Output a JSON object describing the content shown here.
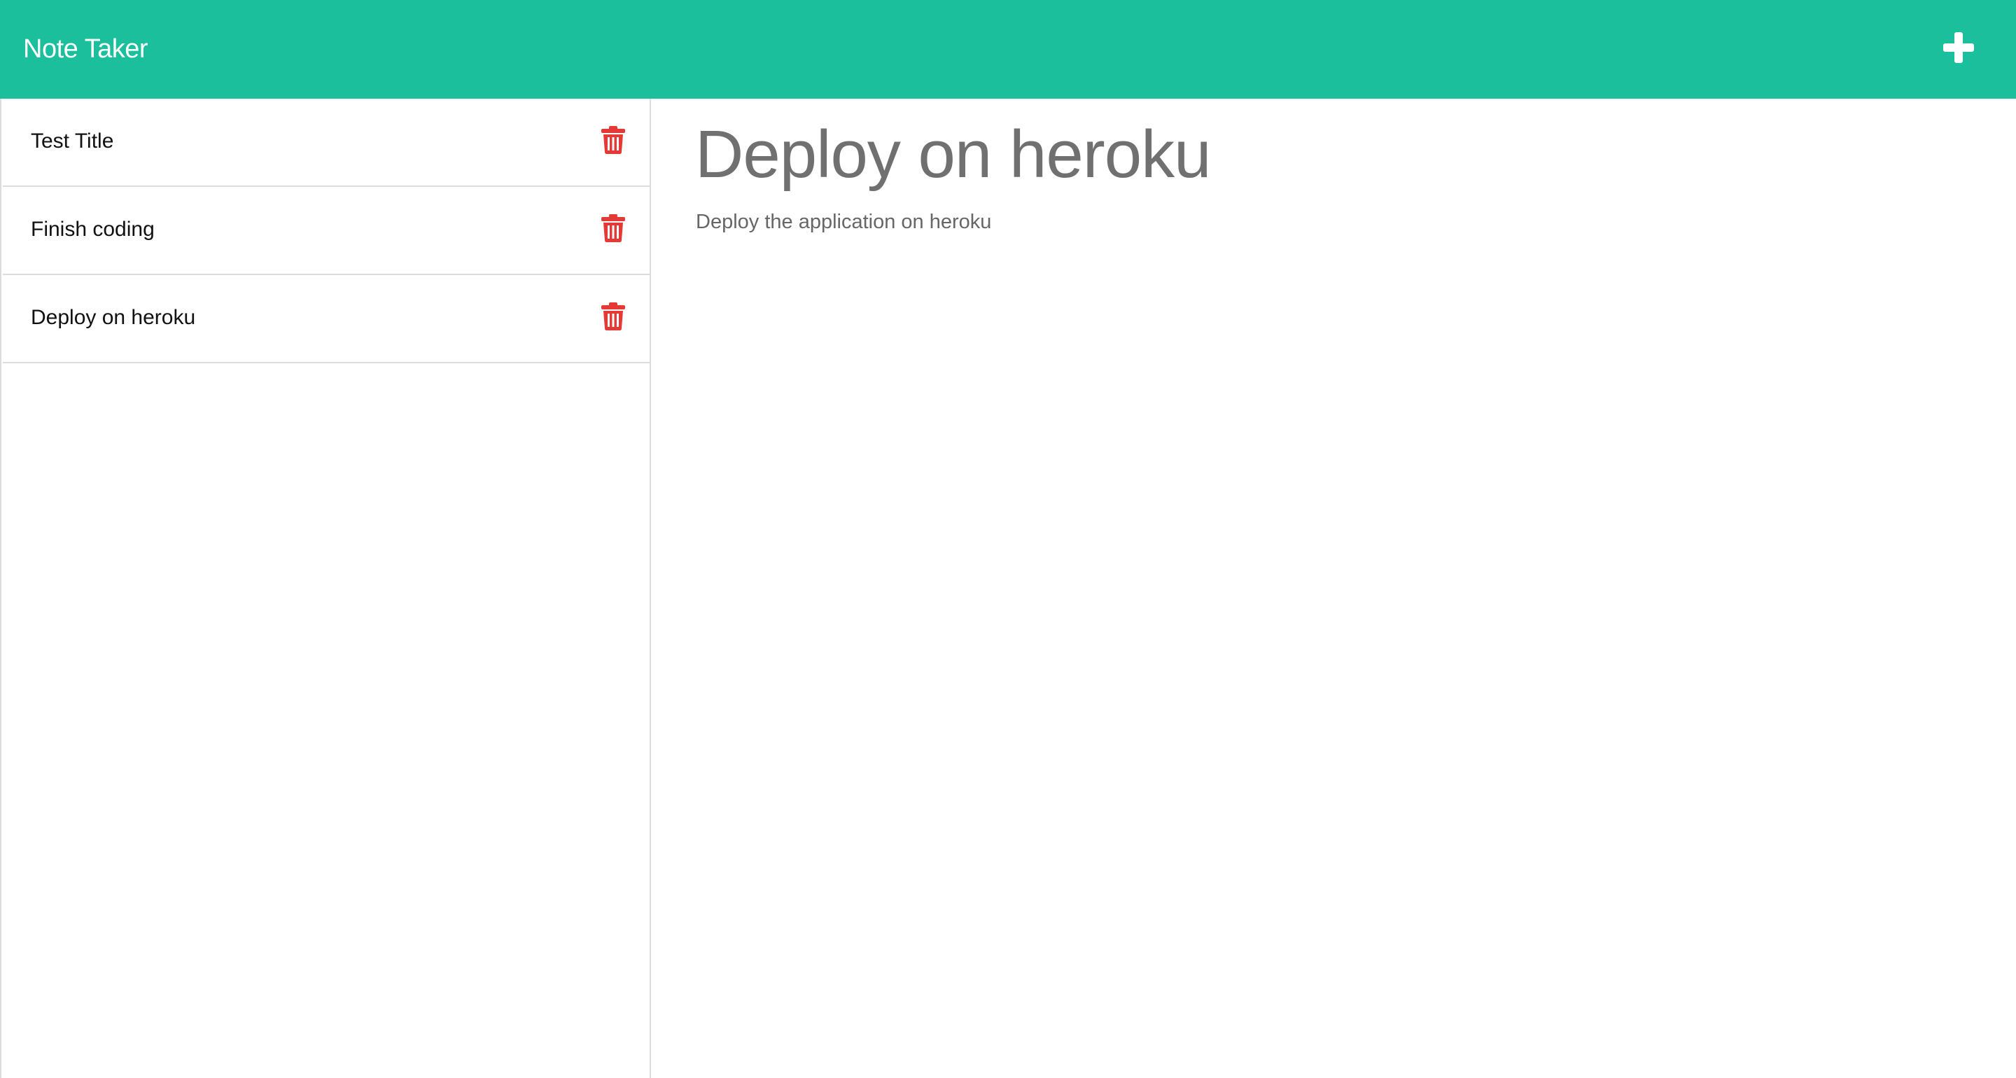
{
  "app": {
    "brand": "Note Taker",
    "accent_color": "#1bbf9c",
    "delete_color": "#e53935"
  },
  "navbar": {
    "new_note_icon": "plus-icon"
  },
  "sidebar": {
    "notes": [
      {
        "title": "Test Title",
        "icon": "trash-icon"
      },
      {
        "title": "Finish coding",
        "icon": "trash-icon"
      },
      {
        "title": "Deploy on heroku",
        "icon": "trash-icon"
      }
    ]
  },
  "active_note": {
    "title": "Deploy on heroku",
    "text": "Deploy the application on heroku"
  }
}
